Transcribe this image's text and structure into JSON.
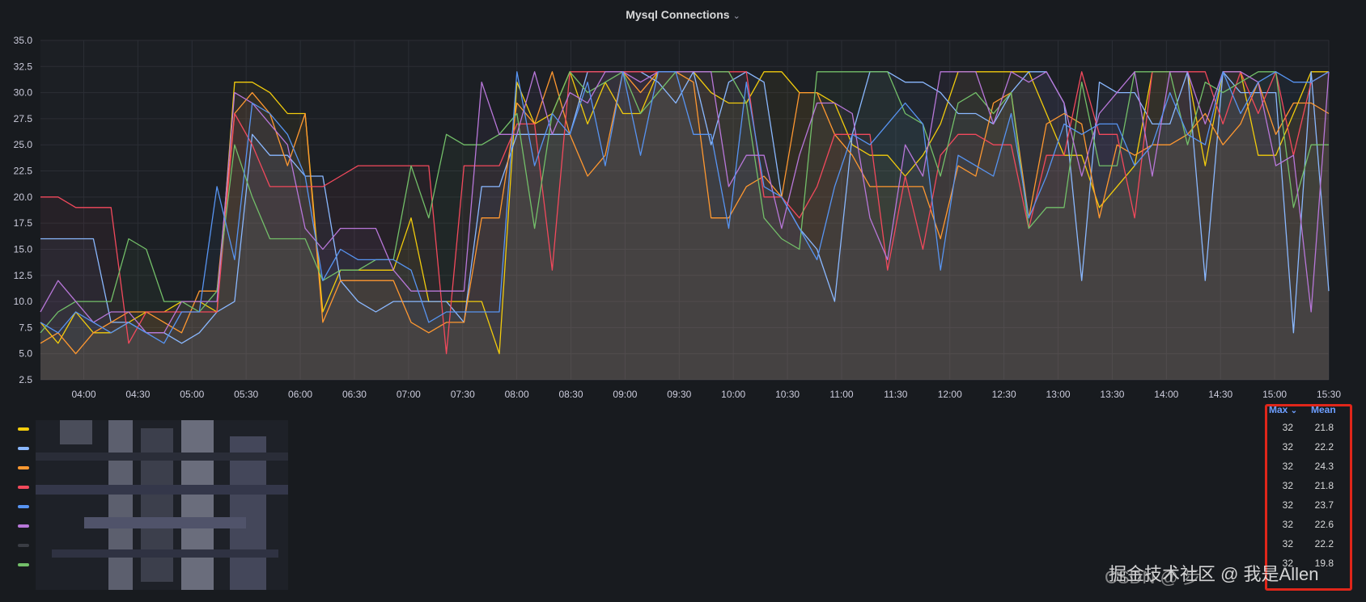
{
  "panel": {
    "title": "Mysql Connections",
    "title_caret": "⌄"
  },
  "chart_data": {
    "type": "line",
    "title": "Mysql Connections",
    "ylim": [
      2.5,
      35
    ],
    "yticks": [
      "2.5",
      "5.0",
      "7.5",
      "10.0",
      "12.5",
      "15.0",
      "17.5",
      "20.0",
      "22.5",
      "25.0",
      "27.5",
      "30.0",
      "32.5",
      "35.0"
    ],
    "xticks": [
      "04:00",
      "04:30",
      "05:00",
      "05:30",
      "06:00",
      "06:30",
      "07:00",
      "07:30",
      "08:00",
      "08:30",
      "09:00",
      "09:30",
      "10:00",
      "10:30",
      "11:00",
      "11:30",
      "12:00",
      "12:30",
      "13:00",
      "13:30",
      "14:00",
      "14:30",
      "15:00",
      "15:30"
    ],
    "x_start": "03:36",
    "x_end": "15:30",
    "grid": true,
    "series": [
      {
        "color": "#f2cc0c",
        "values": [
          8,
          6,
          9,
          7,
          7,
          8,
          9,
          9,
          10,
          10,
          9,
          31,
          31,
          30,
          28,
          28,
          9,
          13,
          13,
          13,
          13,
          18,
          10,
          10,
          10,
          10,
          5,
          31,
          27,
          28,
          32,
          27,
          31,
          28,
          28,
          32,
          32,
          32,
          30,
          29,
          29,
          32,
          32,
          30,
          30,
          29,
          25,
          24,
          24,
          22,
          24,
          27,
          32,
          32,
          32,
          32,
          32,
          28,
          24,
          24,
          19,
          21,
          23,
          32,
          32,
          32,
          23,
          32,
          32,
          24,
          24,
          28,
          32,
          32
        ]
      },
      {
        "color": "#8ab8ff",
        "values": [
          16,
          16,
          16,
          16,
          8,
          8,
          7,
          7,
          6,
          7,
          9,
          10,
          26,
          24,
          24,
          22,
          22,
          12,
          10,
          9,
          10,
          10,
          10,
          10,
          8,
          21,
          21,
          26,
          26,
          26,
          26,
          32,
          32,
          32,
          32,
          31,
          29,
          32,
          25,
          31,
          32,
          31,
          20,
          17,
          15,
          10,
          26,
          32,
          32,
          31,
          31,
          30,
          28,
          28,
          27,
          30,
          32,
          32,
          29,
          12,
          31,
          30,
          30,
          27,
          27,
          32,
          12,
          32,
          30,
          30,
          30,
          7,
          32,
          11
        ]
      },
      {
        "color": "#ff9830",
        "values": [
          6,
          7,
          5,
          7,
          8,
          9,
          9,
          8,
          7,
          11,
          11,
          28,
          30,
          28,
          23,
          28,
          8,
          12,
          12,
          12,
          12,
          8,
          7,
          8,
          8,
          18,
          18,
          29,
          27,
          32,
          26,
          22,
          24,
          32,
          30,
          32,
          32,
          31,
          18,
          18,
          21,
          22,
          20,
          30,
          30,
          26,
          24,
          21,
          21,
          21,
          21,
          16,
          23,
          22,
          29,
          30,
          18,
          27,
          28,
          27,
          18,
          25,
          24,
          25,
          25,
          26,
          28,
          25,
          27,
          31,
          26,
          29,
          29,
          28
        ]
      },
      {
        "color": "#f2495c",
        "values": [
          20,
          20,
          19,
          19,
          19,
          6,
          9,
          9,
          9,
          9,
          9,
          28,
          25,
          21,
          21,
          21,
          21,
          22,
          23,
          23,
          23,
          23,
          23,
          5,
          23,
          23,
          23,
          27,
          27,
          13,
          32,
          32,
          32,
          32,
          32,
          32,
          32,
          32,
          32,
          32,
          32,
          20,
          20,
          18,
          21,
          26,
          26,
          26,
          13,
          22,
          15,
          24,
          26,
          26,
          25,
          25,
          17,
          24,
          24,
          32,
          26,
          26,
          18,
          32,
          32,
          32,
          32,
          27,
          32,
          28,
          32,
          24,
          31,
          32
        ]
      },
      {
        "color": "#73bf69",
        "values": [
          7,
          9,
          10,
          10,
          10,
          16,
          15,
          10,
          10,
          9,
          11,
          25,
          20,
          16,
          16,
          16,
          12,
          13,
          13,
          14,
          14,
          23,
          18,
          26,
          25,
          25,
          26,
          28,
          17,
          28,
          32,
          30,
          31,
          32,
          28,
          30,
          32,
          32,
          32,
          32,
          29,
          18,
          16,
          15,
          32,
          32,
          32,
          32,
          32,
          28,
          27,
          22,
          29,
          30,
          28,
          30,
          17,
          19,
          19,
          31,
          23,
          23,
          32,
          32,
          32,
          25,
          31,
          30,
          31,
          32,
          32,
          19,
          25,
          25
        ]
      },
      {
        "color": "#b877d9",
        "values": [
          9,
          12,
          10,
          8,
          9,
          9,
          7,
          7,
          10,
          10,
          10,
          30,
          29,
          27,
          25,
          17,
          15,
          17,
          17,
          17,
          13,
          11,
          11,
          11,
          11,
          31,
          26,
          26,
          32,
          26,
          30,
          29,
          32,
          32,
          31,
          32,
          32,
          32,
          32,
          21,
          24,
          24,
          17,
          24,
          29,
          29,
          28,
          18,
          14,
          25,
          22,
          32,
          32,
          32,
          27,
          32,
          31,
          32,
          29,
          22,
          28,
          30,
          32,
          22,
          32,
          32,
          27,
          32,
          32,
          31,
          23,
          24,
          9,
          32
        ]
      },
      {
        "color": "#5794f2",
        "values": [
          8,
          7,
          9,
          8,
          7,
          8,
          7,
          6,
          9,
          9,
          21,
          14,
          29,
          28,
          26,
          22,
          12,
          15,
          14,
          14,
          14,
          13,
          8,
          9,
          9,
          9,
          9,
          32,
          23,
          28,
          26,
          31,
          23,
          32,
          24,
          32,
          32,
          26,
          26,
          17,
          31,
          21,
          20,
          17,
          14,
          21,
          26,
          25,
          27,
          29,
          27,
          13,
          24,
          23,
          22,
          28,
          18,
          22,
          27,
          26,
          27,
          27,
          23,
          25,
          30,
          26,
          25,
          32,
          28,
          31,
          32,
          31,
          31,
          32
        ]
      }
    ]
  },
  "legend": {
    "header_max": "Max",
    "header_max_caret": "⌄",
    "header_mean": "Mean",
    "rows": [
      {
        "max": "32",
        "mean": "21.8",
        "color": "#f2cc0c"
      },
      {
        "max": "32",
        "mean": "22.2",
        "color": "#8ab8ff"
      },
      {
        "max": "32",
        "mean": "24.3",
        "color": "#ff9830"
      },
      {
        "max": "32",
        "mean": "21.8",
        "color": "#f2495c"
      },
      {
        "max": "32",
        "mean": "23.7",
        "color": "#5794f2"
      },
      {
        "max": "32",
        "mean": "22.6",
        "color": "#b877d9"
      },
      {
        "max": "32",
        "mean": "22.2",
        "color": "#3a3d44"
      },
      {
        "max": "32",
        "mean": "19.8",
        "color": "#73bf69"
      }
    ]
  },
  "watermarks": {
    "corner": "掘金技术社区 @ 我是Allen",
    "corner_overlay": "CSDN @ 步"
  }
}
